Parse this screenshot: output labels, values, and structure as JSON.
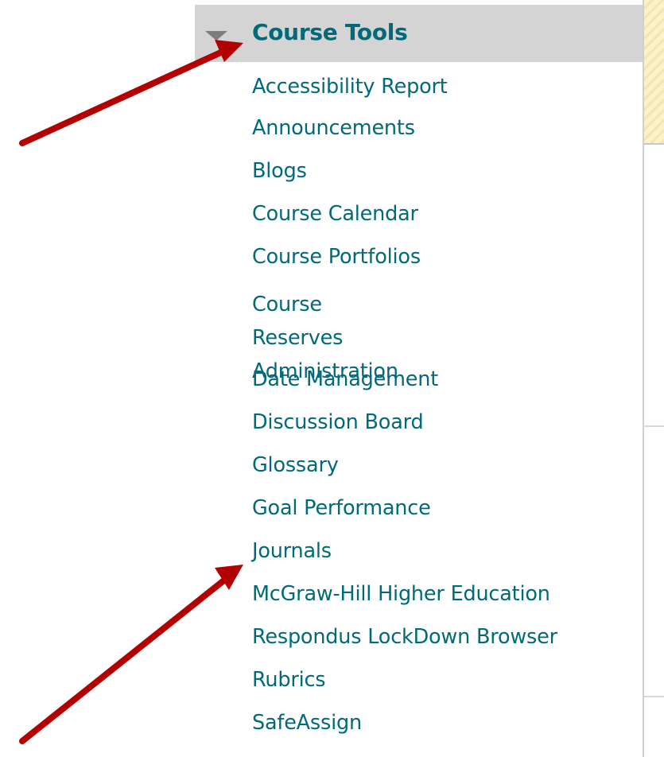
{
  "menu": {
    "section_title": "Course Tools",
    "items": [
      {
        "label": "Accessibility Report"
      },
      {
        "label": "Announcements"
      },
      {
        "label": "Blogs"
      },
      {
        "label": "Course Calendar"
      },
      {
        "label": "Course Portfolios"
      },
      {
        "label": "Course Reserves\nAdministration"
      },
      {
        "label": "Date Management"
      },
      {
        "label": "Discussion Board"
      },
      {
        "label": "Glossary"
      },
      {
        "label": "Goal Performance"
      },
      {
        "label": "Journals"
      },
      {
        "label": "McGraw-Hill Higher Education"
      },
      {
        "label": "Respondus LockDown Browser"
      },
      {
        "label": "Rubrics"
      },
      {
        "label": "SafeAssign"
      }
    ]
  },
  "colors": {
    "link": "#006a78",
    "header_bg": "#d4d4d4",
    "arrow": "#b30000"
  },
  "icons": {
    "toggle": "triangle-down-icon",
    "annotation": "red-arrow-icon"
  }
}
